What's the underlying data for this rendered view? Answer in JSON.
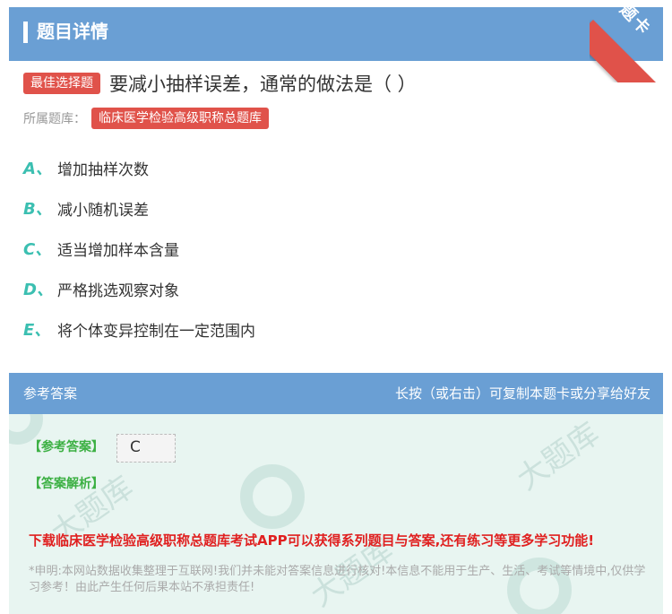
{
  "header": {
    "title": "题目详情",
    "ribbon": "题卡"
  },
  "question": {
    "tag": "最佳选择题",
    "text": "要减小抽样误差，通常的做法是（ ）"
  },
  "source": {
    "label": "所属题库：",
    "value": "临床医学检验高级职称总题库"
  },
  "options": [
    {
      "letter": "A、",
      "text": "增加抽样次数"
    },
    {
      "letter": "B、",
      "text": "减小随机误差"
    },
    {
      "letter": "C、",
      "text": "适当增加样本含量"
    },
    {
      "letter": "D、",
      "text": "严格挑选观察对象"
    },
    {
      "letter": "E、",
      "text": "将个体变异控制在一定范围内"
    }
  ],
  "answer_section": {
    "title": "参考答案",
    "hint": "长按（或右击）可复制本题卡或分享给好友",
    "answer_label": "【参考答案】",
    "answer_value": "C",
    "analysis_label": "【答案解析】",
    "promo": "下载临床医学检验高级职称总题库考试APP可以获得系列题目与答案,还有练习等更多学习功能!",
    "disclaimer": "*申明:本网站数据收集整理于互联网!我们并未能对答案信息进行核对!本信息不能用于生产、生活、考试等情境中,仅供学习参考！由此产生任何后果本站不承担责任!"
  },
  "colors": {
    "accent": "#6a9fd4",
    "tag": "#e0524a",
    "option_letter": "#3bbfb1",
    "answer_label": "#3cb043",
    "promo": "#e02020"
  }
}
